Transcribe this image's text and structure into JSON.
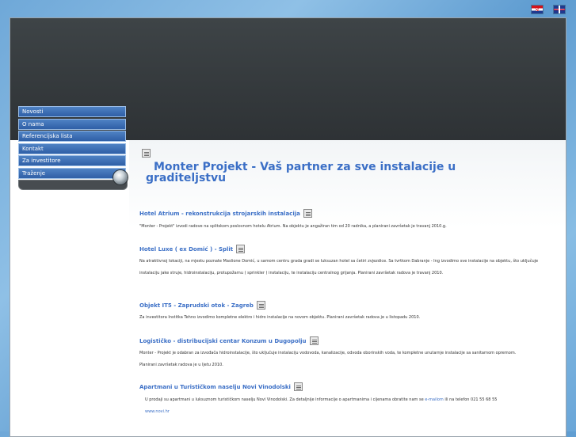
{
  "flags": {
    "croatian_icon": "croatian-flag-icon",
    "english_icon": "english-flag-icon"
  },
  "menu": {
    "items": [
      {
        "label": "Novosti"
      },
      {
        "label": "O nama"
      },
      {
        "label": "Referencijska lista"
      },
      {
        "label": "Kontakt"
      },
      {
        "label": "Za investitore"
      },
      {
        "label": "Traženje"
      }
    ]
  },
  "main": {
    "title": "Monter Projekt  - Vaš partner za sve instalacije u graditeljstvu",
    "sections": [
      {
        "heading": "Hotel Atrium - rekonstrukcija strojarskih instalacija",
        "lines": [
          "\"Monter - Projekt\" izvodi radove na splitskom poslovnom hotelu Atrium. Na objektu je angažiran tim od 20 radnika, a planirani završetak je travanj 2010.g."
        ]
      },
      {
        "heading": "Hotel Luxe ( ex Domić ) - Split",
        "lines": [
          "Na atraktivnoj lokaciji, na mjestu poznate Maslione Domić,  u samom centru grada gradi se luksuzan hotel sa četiri zvjezdice. Sa tvrtkom Dabranje - Ing izvodimo sve instalacije na objektu, što uključuje",
          "instalaciju jake struje, hidroinstalaciju, protupožarnu ( sprinkler ) instalaciju, te instalaciju centralnog grijanja. Planirani završetak radova je travanj 2010."
        ]
      },
      {
        "heading": "Objekt IT5 - Zaprudski otok - Zagreb",
        "lines": [
          "Za investitora Institka Tehno izvodimo kompletne elektro i hidro instalacije na novom objektu. Planirani završetak radova je u listopadu 2010."
        ]
      },
      {
        "heading": "Logističko - distribucijski centar Konzum u Dugopolju",
        "lines": [
          "Monter - Projekt je odabran za izvođača hidroinstalacije, što uključuje instalaciju vodovoda, kanalizacije, odvoda oborinskih voda, te kompletne unutarnje instalacije sa sanitarnom opremom.",
          "Planirani završetak radova je u ljetu 2010."
        ]
      },
      {
        "heading": "Apartmani u Turističkom naselju Novi Vinodolski",
        "lines": [
          "U prodaji su apartmani u luksuznom turističkom naselju Novi Vinodolski. Za detaljnije informacije o apartmanima i cijenama obratite nam se",
          "e-mailom",
          "ili na telefon 021 55 68 55",
          "www.novi.hr"
        ]
      }
    ]
  }
}
